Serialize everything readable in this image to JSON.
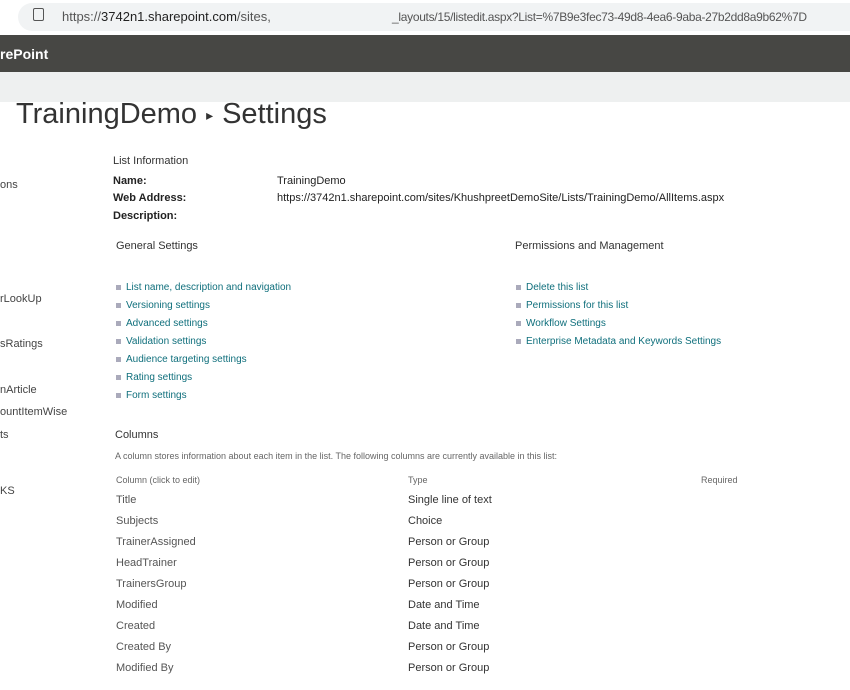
{
  "browser": {
    "url_start": "https://",
    "url_host": "3742n1.sharepoint.com",
    "url_path": "/sites,",
    "url_end": "_layouts/15/listedit.aspx?List=%7B9e3fec73-49d8-4ea6-9aba-27b2dd8a9b62%7D"
  },
  "suite": {
    "brand": "rePoint"
  },
  "page": {
    "list": "TrainingDemo",
    "separator": "▸",
    "current": "Settings"
  },
  "leftnav": [
    "ons",
    "rLookUp",
    "sRatings",
    "nArticle",
    "ountItemWise",
    "ts",
    "KS"
  ],
  "info": {
    "heading": "List Information",
    "name_label": "Name:",
    "name_value": "TrainingDemo",
    "web_label": "Web Address:",
    "web_value": "https://3742n1.sharepoint.com/sites/KhushpreetDemoSite/Lists/TrainingDemo/AllItems.aspx",
    "desc_label": "Description:"
  },
  "general": {
    "heading": "General Settings",
    "links": [
      "List name, description and navigation",
      "Versioning settings",
      "Advanced settings",
      "Validation settings",
      "Audience targeting settings",
      "Rating settings",
      "Form settings"
    ]
  },
  "permissions": {
    "heading": "Permissions and Management",
    "links": [
      "Delete this list",
      "Permissions for this list",
      "Workflow Settings",
      "Enterprise Metadata and Keywords Settings"
    ]
  },
  "columns": {
    "heading": "Columns",
    "description": "A column stores information about each item in the list. The following columns are currently available in this list:",
    "headers": {
      "column": "Column (click to edit)",
      "type": "Type",
      "required": "Required"
    },
    "rows": [
      {
        "name": "Title",
        "type": "Single line of text"
      },
      {
        "name": "Subjects",
        "type": "Choice"
      },
      {
        "name": "TrainerAssigned",
        "type": "Person or Group"
      },
      {
        "name": "HeadTrainer",
        "type": "Person or Group"
      },
      {
        "name": "TrainersGroup",
        "type": "Person or Group"
      },
      {
        "name": "Modified",
        "type": "Date and Time"
      },
      {
        "name": "Created",
        "type": "Date and Time"
      },
      {
        "name": "Created By",
        "type": "Person or Group"
      },
      {
        "name": "Modified By",
        "type": "Person or Group"
      }
    ]
  }
}
